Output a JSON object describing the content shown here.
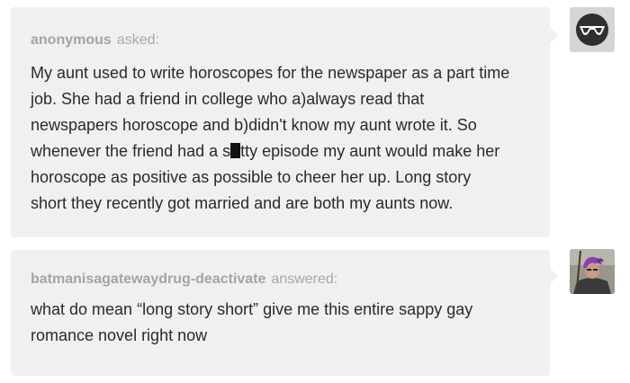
{
  "ask": {
    "username": "anonymous",
    "verb": "asked:",
    "line_1": "My aunt used to write horoscopes for the newspaper as a part time",
    "line_2": "job. She had a friend in college who a)always read that",
    "line_3": "newspapers horoscope and b)didn't know my aunt wrote it. So",
    "line_4_before": "whenever the friend had a s",
    "line_4_after": "tty episode my aunt would make her",
    "line_5": "horoscope as positive as possible to cheer her up. Long story",
    "line_6": "short they recently got married and are both my aunts now."
  },
  "answer": {
    "username": "batmanisagatewaydrug-deactivate",
    "verb": "answered:",
    "line_1": "what do mean “long story short” give me this entire sappy gay",
    "line_2": "romance novel right now"
  },
  "avatars": {
    "anonymous": "anonymous-sunglasses-icon",
    "answerer": "user-photo"
  },
  "colors": {
    "bubble_background": "#f0f0f0",
    "meta_text": "#a8a8a8",
    "body_text": "#2a2a2a"
  }
}
